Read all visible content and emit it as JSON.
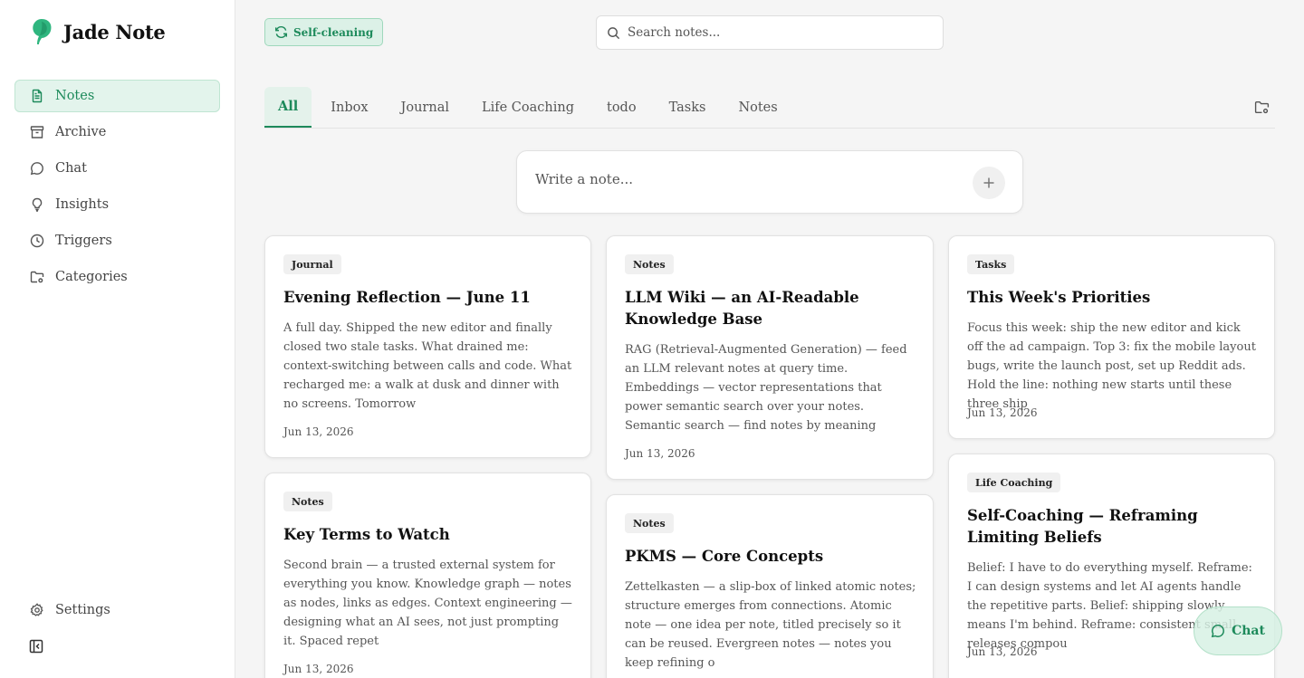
{
  "app": {
    "name": "Jade Note"
  },
  "sidebar": {
    "items": [
      {
        "label": "Notes",
        "icon": "notes-icon",
        "active": true
      },
      {
        "label": "Archive",
        "icon": "archive-icon"
      },
      {
        "label": "Chat",
        "icon": "chat-icon"
      },
      {
        "label": "Insights",
        "icon": "lightbulb-icon"
      },
      {
        "label": "Triggers",
        "icon": "clock-icon"
      },
      {
        "label": "Categories",
        "icon": "folder-settings-icon"
      }
    ],
    "settings_label": "Settings"
  },
  "header": {
    "self_cleaning_label": "Self-cleaning",
    "search_placeholder": "Search notes..."
  },
  "tabs": [
    "All",
    "Inbox",
    "Journal",
    "Life Coaching",
    "todo",
    "Tasks",
    "Notes"
  ],
  "active_tab": "All",
  "composer": {
    "placeholder": "Write a note..."
  },
  "cards": [
    {
      "tag": "Journal",
      "title": "Evening Reflection — June 11",
      "body": "A full day. Shipped the new editor and finally closed two stale tasks. What drained me: context-switching between calls and code. What recharged me: a walk at dusk and dinner with no screens. Tomorrow",
      "date": "Jun 13, 2026"
    },
    {
      "tag": "Notes",
      "title": "LLM Wiki — an AI-Readable Knowledge Base",
      "body": "RAG (Retrieval-Augmented Generation) — feed an LLM relevant notes at query time. Embeddings — vector representations that power semantic search over your notes. Semantic search — find notes by meaning",
      "date": "Jun 13, 2026"
    },
    {
      "tag": "Tasks",
      "title": "This Week's Priorities",
      "body": "Focus this week: ship the new editor and kick off the ad campaign. Top 3: fix the mobile layout bugs, write the launch post, set up Reddit ads. Hold the line: nothing new starts until these three ship",
      "date": "Jun 13, 2026"
    },
    {
      "tag": "Notes",
      "title": "Key Terms to Watch",
      "body": "Second brain — a trusted external system for everything you know. Knowledge graph — notes as nodes, links as edges. Context engineering — designing what an AI sees, not just prompting it. Spaced repet",
      "date": "Jun 13, 2026"
    },
    {
      "tag": "Notes",
      "title": "PKMS — Core Concepts",
      "body": "Zettelkasten — a slip-box of linked atomic notes; structure emerges from connections. Atomic note — one idea per note, titled precisely so it can be reused. Evergreen notes — notes you keep refining o",
      "date": ""
    },
    {
      "tag": "Life Coaching",
      "title": "Self-Coaching — Reframing Limiting Beliefs",
      "body": "Belief: I have to do everything myself. Reframe: I can design systems and let AI agents handle the repetitive parts. Belief: shipping slowly means I'm behind. Reframe: consistent small releases compou",
      "date": "Jun 13, 2026"
    }
  ],
  "chat_fab_label": "Chat",
  "colors": {
    "accent": "#1d8a5b",
    "accent_bg": "#e3f4ec"
  }
}
